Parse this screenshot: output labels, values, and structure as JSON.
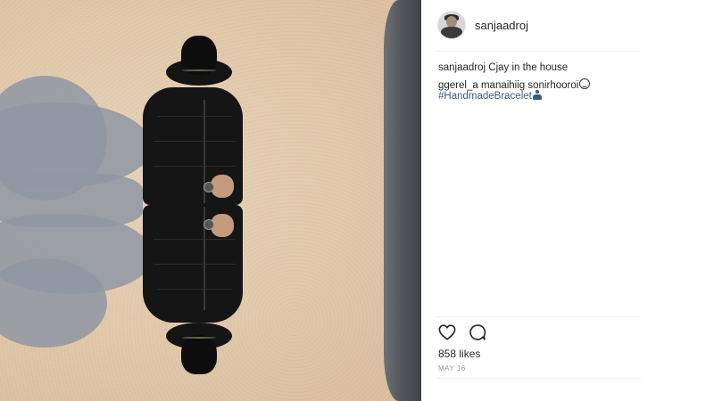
{
  "post": {
    "username": "sanjaadroj",
    "caption": {
      "username": "sanjaadroj",
      "text": "Cjay in the house"
    },
    "comments": [
      {
        "username": "ggerel_a",
        "text": "manaihiig sonirhooroi"
      }
    ],
    "hashtag": "#HandmadeBracelet",
    "likes_text": "858 likes",
    "date": "MAY 16"
  },
  "icons": {
    "like": "heart-icon",
    "comment": "comment-icon",
    "smile_emoji": "smile-emoji-icon",
    "figure_emoji": "person-emoji-icon"
  },
  "colors": {
    "hashtag": "#3b5a82",
    "text": "#262626",
    "muted": "#999999"
  }
}
